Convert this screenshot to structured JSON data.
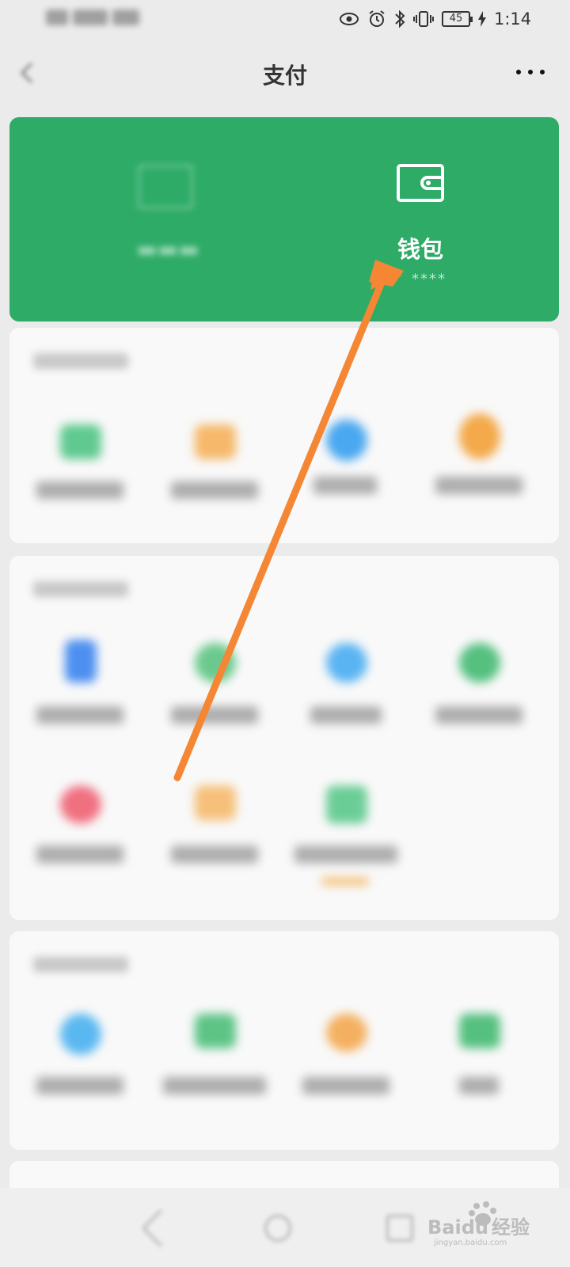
{
  "status_bar": {
    "battery": "45",
    "time": "1:14"
  },
  "header": {
    "title": "支付"
  },
  "card": {
    "wallet_label": "钱包",
    "wallet_amount": "****"
  },
  "watermark": {
    "brand": "Baidu",
    "brand_cn": "经验",
    "url": "jingyan.baidu.com"
  },
  "colors": {
    "card_green": "#2eab67",
    "arrow": "#f58634"
  }
}
